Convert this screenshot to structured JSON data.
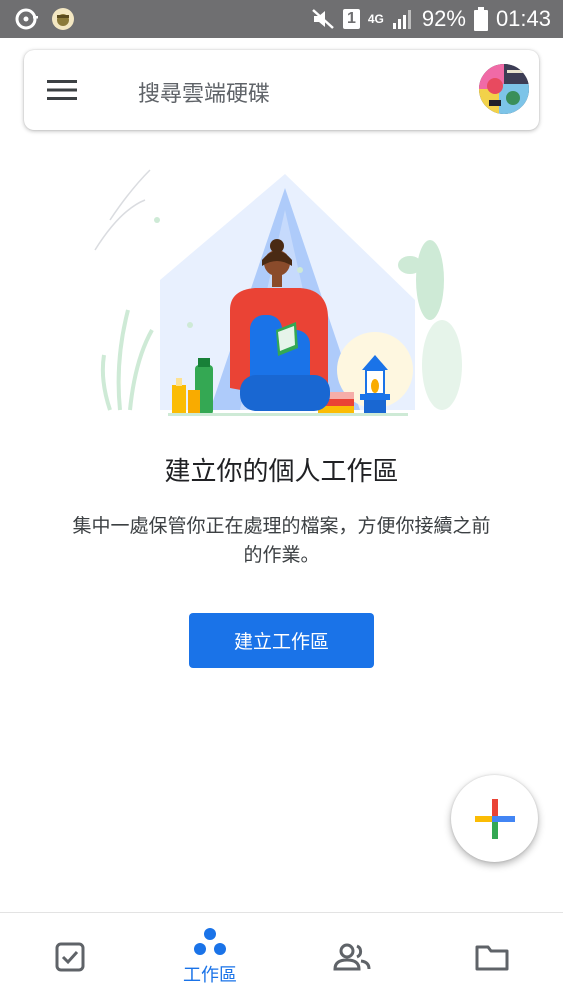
{
  "status_bar": {
    "battery": "92%",
    "time": "01:43",
    "network": "4G",
    "sim": "1"
  },
  "search": {
    "placeholder": "搜尋雲端硬碟"
  },
  "empty_state": {
    "title": "建立你的個人工作區",
    "description": "集中一處保管你正在處理的檔案，方便你接續之前的作業。",
    "button_label": "建立工作區"
  },
  "bottom_nav": {
    "items": [
      {
        "icon": "priority-check-icon",
        "label": ""
      },
      {
        "icon": "workspaces-icon",
        "label": "工作區",
        "active": true
      },
      {
        "icon": "shared-people-icon",
        "label": ""
      },
      {
        "icon": "files-folder-icon",
        "label": ""
      }
    ]
  },
  "colors": {
    "accent": "#1a73e8",
    "status_bar": "#6f6f71",
    "fab_blue": "#4285f4",
    "fab_red": "#ea4335",
    "fab_yellow": "#fbbc04",
    "fab_green": "#34a853"
  }
}
